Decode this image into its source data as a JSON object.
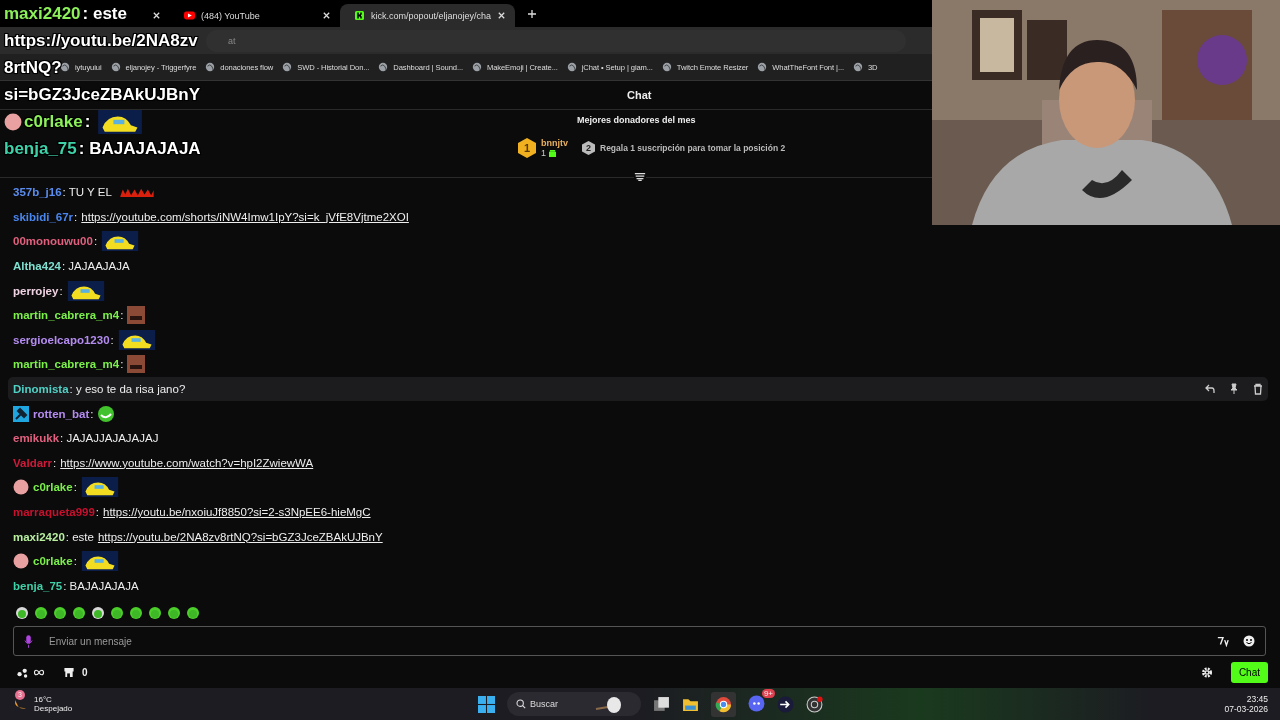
{
  "browser": {
    "tabs": [
      {
        "selected": false
      },
      {
        "label": "(484) YouTube",
        "selected": false,
        "kind": "youtube"
      },
      {
        "label": "kick.com/popout/eljanojey/cha",
        "selected": true,
        "kind": "kick"
      }
    ],
    "address": "at",
    "bookmarks": [
      "iytuyuiui",
      "eljanojey - Triggerfyre",
      "donaciones flow",
      "SWD - Historial Don...",
      "Dashboard | Sound...",
      "MakeEmoji | Create...",
      "jChat • Setup | giam...",
      "Twitch Emote Resizer",
      "WhatTheFont Font |...",
      "3D"
    ]
  },
  "overlay": [
    {
      "user": "maxi2420",
      "color": "#8cf05a",
      "parts": [
        {
          "kind": "text",
          "text": ": este"
        }
      ]
    },
    {
      "parts": [
        {
          "kind": "text",
          "text": "https://youtu.be/2NA8zv"
        }
      ]
    },
    {
      "parts": [
        {
          "kind": "text",
          "text": "8rtNQ?"
        }
      ]
    },
    {
      "parts": [
        {
          "kind": "text",
          "text": "si=bGZ3JceZBAkUJBnY"
        }
      ]
    },
    {
      "user": "c0rlake",
      "color": "#8cf05a",
      "avatar": true,
      "parts": [
        {
          "kind": "text",
          "text": ":"
        },
        {
          "kind": "car"
        }
      ]
    },
    {
      "user": "benja_75",
      "color": "#3fd1a8",
      "parts": [
        {
          "kind": "text",
          "text": ": BAJAJAJAJA"
        }
      ]
    }
  ],
  "chat": {
    "title": "Chat",
    "donors_title": "Mejores donadores del mes",
    "donor": {
      "rank": "1",
      "name": "bnnjtv",
      "count": "1"
    },
    "hint": {
      "rank": "2",
      "text": "Regala 1 suscripción para tomar la posición 2"
    },
    "messages": [
      {
        "user": "357b_j16",
        "color": "#5b8def",
        "highlighted": false,
        "parts": [
          {
            "kind": "text",
            "text": ": TU Y EL"
          },
          {
            "kind": "fire"
          }
        ]
      },
      {
        "user": "skibidi_67r",
        "color": "#4a86f0",
        "highlighted": false,
        "parts": [
          {
            "kind": "text",
            "text": ":"
          },
          {
            "kind": "link",
            "text": "https://youtube.com/shorts/iNW4Imw1IpY?si=k_jVfE8Vjtme2XOI"
          }
        ]
      },
      {
        "user": "00monouwu00",
        "color": "#e0607e",
        "highlighted": false,
        "parts": [
          {
            "kind": "text",
            "text": ":"
          },
          {
            "kind": "car"
          }
        ]
      },
      {
        "user": "Altha424",
        "color": "#7fe0d0",
        "highlighted": false,
        "parts": [
          {
            "kind": "text",
            "text": ": JAJAAJAJA"
          }
        ]
      },
      {
        "user": "perrojey",
        "color": "#f0d4e4",
        "highlighted": false,
        "parts": [
          {
            "kind": "text",
            "text": ":"
          },
          {
            "kind": "car"
          }
        ]
      },
      {
        "user": "martin_cabrera_m4",
        "color": "#7cf04a",
        "highlighted": false,
        "parts": [
          {
            "kind": "text",
            "text": ":"
          },
          {
            "kind": "face"
          }
        ]
      },
      {
        "user": "sergioelcapo1230",
        "color": "#b48cf0",
        "highlighted": false,
        "parts": [
          {
            "kind": "text",
            "text": ":"
          },
          {
            "kind": "car"
          }
        ]
      },
      {
        "user": "martin_cabrera_m4",
        "color": "#7cf04a",
        "highlighted": false,
        "parts": [
          {
            "kind": "text",
            "text": ":"
          },
          {
            "kind": "face"
          }
        ]
      },
      {
        "user": "Dinomista",
        "color": "#4fd1c5",
        "highlighted": true,
        "parts": [
          {
            "kind": "text",
            "text": ": y eso te da risa jano?"
          }
        ]
      },
      {
        "user": "rotten_bat",
        "color": "#b48cf0",
        "moderator": true,
        "highlighted": false,
        "parts": [
          {
            "kind": "text",
            "text": ":"
          },
          {
            "kind": "frog"
          }
        ]
      },
      {
        "user": "emikukk",
        "color": "#e0607e",
        "highlighted": false,
        "parts": [
          {
            "kind": "text",
            "text": ": JAJAJJAJAJAJAJ"
          }
        ]
      },
      {
        "user": "Valdarr",
        "color": "#d01a3a",
        "highlighted": false,
        "parts": [
          {
            "kind": "text",
            "text": ":"
          },
          {
            "kind": "link",
            "text": "https://www.youtube.com/watch?v=hpI2ZwiewWA"
          }
        ]
      },
      {
        "user": "c0rlake",
        "color": "#7cf04a",
        "avatar": true,
        "highlighted": false,
        "parts": [
          {
            "kind": "text",
            "text": ":"
          },
          {
            "kind": "car"
          }
        ]
      },
      {
        "user": "marraqueta999",
        "color": "#c8102e",
        "highlighted": false,
        "parts": [
          {
            "kind": "text",
            "text": ":"
          },
          {
            "kind": "link",
            "text": "https://youtu.be/nxoiuJf8850?si=2-s3NpEE6-hieMgC"
          }
        ]
      },
      {
        "user": "maxi2420",
        "color": "#b8f0a0",
        "highlighted": false,
        "parts": [
          {
            "kind": "text",
            "text": ": este"
          },
          {
            "kind": "link",
            "text": "https://youtu.be/2NA8zv8rtNQ?si=bGZ3JceZBAkUJBnY"
          }
        ]
      },
      {
        "user": "c0rlake",
        "color": "#7cf04a",
        "avatar": true,
        "highlighted": false,
        "parts": [
          {
            "kind": "text",
            "text": ":"
          },
          {
            "kind": "car"
          }
        ]
      },
      {
        "user": "benja_75",
        "color": "#3fd1a8",
        "highlighted": false,
        "parts": [
          {
            "kind": "text",
            "text": ": BAJAJAJAJA"
          }
        ]
      }
    ],
    "input": {
      "placeholder": "Enviar un mensaje"
    },
    "store_count": "0",
    "send_label": "Chat"
  },
  "taskbar": {
    "temperature": "16°C",
    "weather": "Despejado",
    "weather_badge": "3",
    "search": {
      "placeholder": "Buscar"
    },
    "discord_badge": "9+",
    "time": "23:45",
    "date": "07-03-2026"
  }
}
